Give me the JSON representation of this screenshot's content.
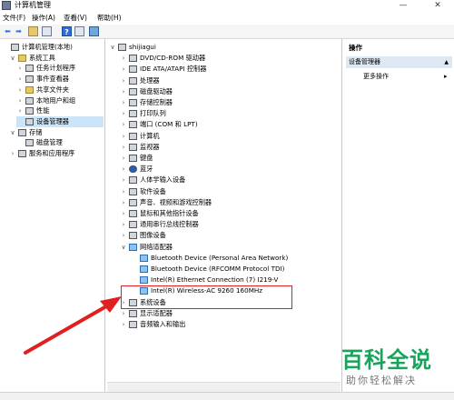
{
  "window": {
    "title": "计算机管理",
    "minimize_icon": "—",
    "close_icon": "✕"
  },
  "menu": [
    "文件(F)",
    "操作(A)",
    "查看(V)",
    "帮助(H)"
  ],
  "left_tree": [
    {
      "label": "计算机管理(本地)",
      "level": 0,
      "chev": "",
      "icon": "computer"
    },
    {
      "label": "系统工具",
      "level": 1,
      "chev": "∨",
      "icon": "tools"
    },
    {
      "label": "任务计划程序",
      "level": 2,
      "chev": "›",
      "icon": "clock"
    },
    {
      "label": "事件查看器",
      "level": 2,
      "chev": "›",
      "icon": "log"
    },
    {
      "label": "共享文件夹",
      "level": 2,
      "chev": "›",
      "icon": "folder"
    },
    {
      "label": "本地用户和组",
      "level": 2,
      "chev": "›",
      "icon": "users"
    },
    {
      "label": "性能",
      "level": 2,
      "chev": "›",
      "icon": "perf"
    },
    {
      "label": "设备管理器",
      "level": 2,
      "chev": "",
      "icon": "devmgr",
      "selected": true
    },
    {
      "label": "存储",
      "level": 1,
      "chev": "∨",
      "icon": "storage"
    },
    {
      "label": "磁盘管理",
      "level": 2,
      "chev": "",
      "icon": "disk"
    },
    {
      "label": "服务和应用程序",
      "level": 1,
      "chev": "›",
      "icon": "services"
    }
  ],
  "device_tree": [
    {
      "label": "shijiagui",
      "level": 0,
      "chev": "∨",
      "icon": "computer"
    },
    {
      "label": "DVD/CD-ROM 驱动器",
      "level": 1,
      "chev": "›",
      "icon": "dev"
    },
    {
      "label": "IDE ATA/ATAPI 控制器",
      "level": 1,
      "chev": "›",
      "icon": "dev"
    },
    {
      "label": "处理器",
      "level": 1,
      "chev": "›",
      "icon": "dev"
    },
    {
      "label": "磁盘驱动器",
      "level": 1,
      "chev": "›",
      "icon": "dev"
    },
    {
      "label": "存储控制器",
      "level": 1,
      "chev": "›",
      "icon": "dev"
    },
    {
      "label": "打印队列",
      "level": 1,
      "chev": "›",
      "icon": "dev"
    },
    {
      "label": "端口 (COM 和 LPT)",
      "level": 1,
      "chev": "›",
      "icon": "dev"
    },
    {
      "label": "计算机",
      "level": 1,
      "chev": "›",
      "icon": "dev"
    },
    {
      "label": "监视器",
      "level": 1,
      "chev": "›",
      "icon": "dev"
    },
    {
      "label": "键盘",
      "level": 1,
      "chev": "›",
      "icon": "dev"
    },
    {
      "label": "蓝牙",
      "level": 1,
      "chev": "›",
      "icon": "bt"
    },
    {
      "label": "人体学输入设备",
      "level": 1,
      "chev": "›",
      "icon": "dev"
    },
    {
      "label": "软件设备",
      "level": 1,
      "chev": "›",
      "icon": "dev"
    },
    {
      "label": "声音、视频和游戏控制器",
      "level": 1,
      "chev": "›",
      "icon": "dev"
    },
    {
      "label": "鼠标和其他指针设备",
      "level": 1,
      "chev": "›",
      "icon": "dev"
    },
    {
      "label": "通用串行总线控制器",
      "level": 1,
      "chev": "›",
      "icon": "dev"
    },
    {
      "label": "图像设备",
      "level": 1,
      "chev": "›",
      "icon": "dev"
    },
    {
      "label": "网络适配器",
      "level": 1,
      "chev": "∨",
      "icon": "net"
    },
    {
      "label": "Bluetooth Device (Personal Area Network)",
      "level": 2,
      "chev": "",
      "icon": "net"
    },
    {
      "label": "Bluetooth Device (RFCOMM Protocol TDI)",
      "level": 2,
      "chev": "",
      "icon": "net"
    },
    {
      "label": "Intel(R) Ethernet Connection (7) I219-V",
      "level": 2,
      "chev": "",
      "icon": "net"
    },
    {
      "label": "Intel(R) Wireless-AC 9260 160MHz",
      "level": 2,
      "chev": "",
      "icon": "net"
    },
    {
      "label": "系统设备",
      "level": 1,
      "chev": "›",
      "icon": "dev"
    },
    {
      "label": "显示适配器",
      "level": 1,
      "chev": "›",
      "icon": "dev"
    },
    {
      "label": "音频输入和输出",
      "level": 1,
      "chev": "›",
      "icon": "dev"
    }
  ],
  "actions": {
    "header": "操作",
    "section": "设备管理器",
    "section_arrow": "▲",
    "more": "更多操作",
    "more_arrow": "▸"
  },
  "watermark": {
    "title": "百科全说",
    "subtitle": "助你轻松解决"
  },
  "colors": {
    "accent": "#cce4f7",
    "highlight": "#e02020",
    "watermark": "#19a25a"
  }
}
